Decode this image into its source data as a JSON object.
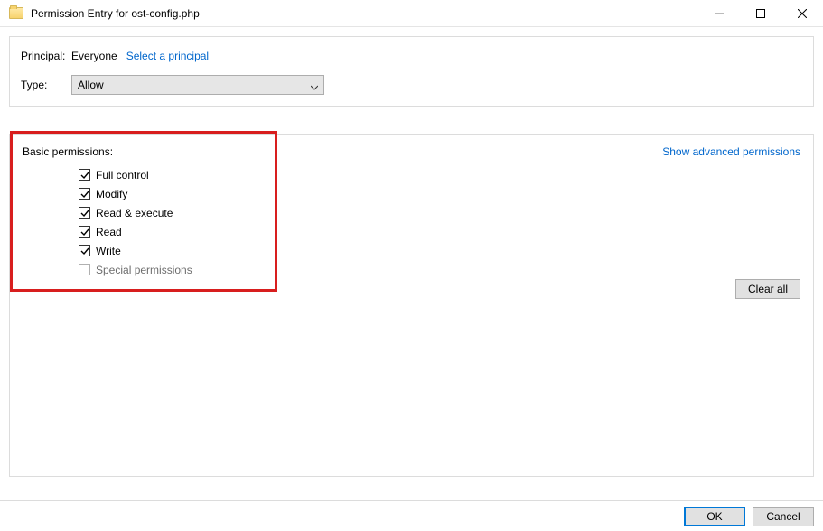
{
  "window": {
    "title": "Permission Entry for ost-config.php"
  },
  "principal": {
    "label": "Principal:",
    "value": "Everyone",
    "select_link": "Select a principal"
  },
  "type": {
    "label": "Type:",
    "selected": "Allow"
  },
  "permissions": {
    "heading": "Basic permissions:",
    "show_advanced": "Show advanced permissions",
    "clear_all": "Clear all",
    "items": [
      {
        "label": "Full control",
        "checked": true,
        "enabled": true
      },
      {
        "label": "Modify",
        "checked": true,
        "enabled": true
      },
      {
        "label": "Read & execute",
        "checked": true,
        "enabled": true
      },
      {
        "label": "Read",
        "checked": true,
        "enabled": true
      },
      {
        "label": "Write",
        "checked": true,
        "enabled": true
      },
      {
        "label": "Special permissions",
        "checked": false,
        "enabled": false
      }
    ]
  },
  "buttons": {
    "ok": "OK",
    "cancel": "Cancel"
  }
}
